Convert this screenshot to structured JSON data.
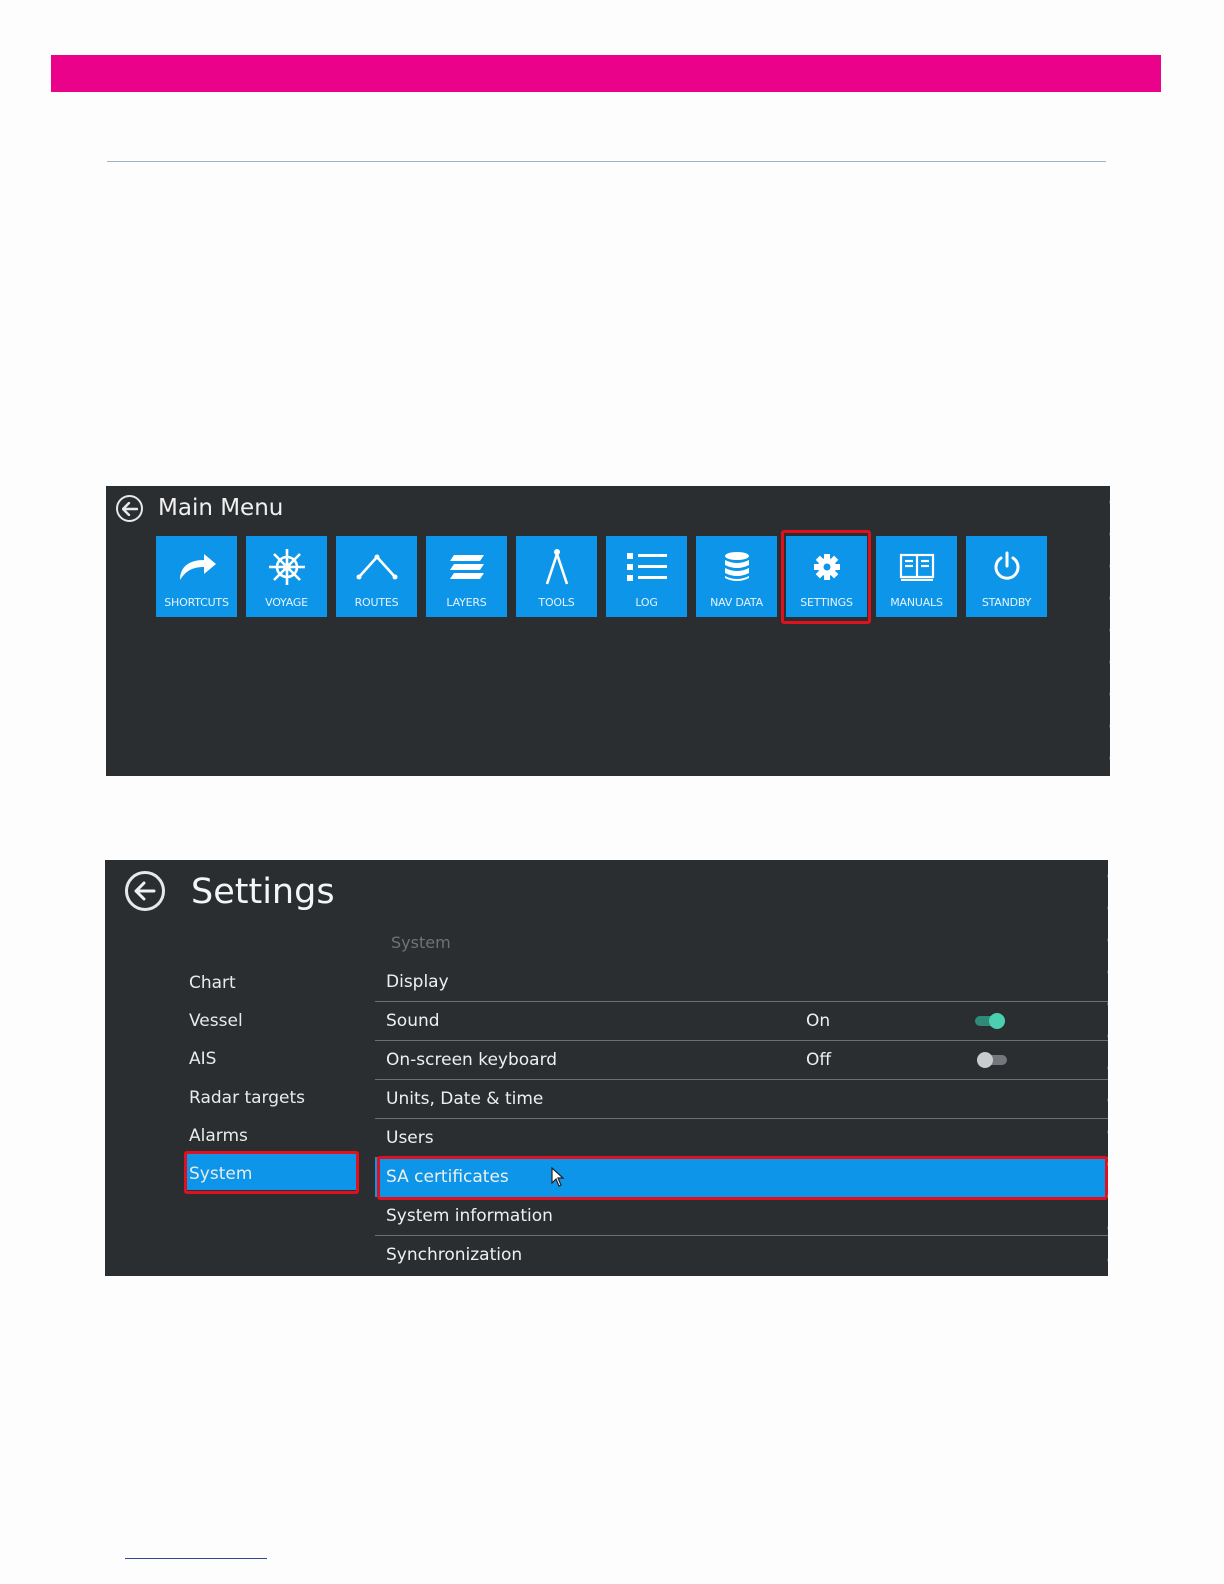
{
  "colors": {
    "accent_bar": "#ea028a",
    "tile_blue": "#0d96e9",
    "panel_bg": "#2a2e31",
    "highlight_red": "#e0101e",
    "toggle_on": "#4ccfb0"
  },
  "main_menu": {
    "title": "Main Menu",
    "tiles": [
      {
        "label": "SHORTCUTS",
        "icon": "shortcut-arrow-icon"
      },
      {
        "label": "VOYAGE",
        "icon": "ship-wheel-icon"
      },
      {
        "label": "ROUTES",
        "icon": "route-icon"
      },
      {
        "label": "LAYERS",
        "icon": "layers-icon"
      },
      {
        "label": "TOOLS",
        "icon": "compass-tool-icon"
      },
      {
        "label": "LOG",
        "icon": "list-icon"
      },
      {
        "label": "NAV DATA",
        "icon": "database-icon"
      },
      {
        "label": "SETTINGS",
        "icon": "gear-icon",
        "highlighted": true
      },
      {
        "label": "MANUALS",
        "icon": "book-icon"
      },
      {
        "label": "STANDBY",
        "icon": "power-icon"
      }
    ]
  },
  "settings": {
    "title": "Settings",
    "section_label": "System",
    "nav": [
      "Chart",
      "Vessel",
      "AIS",
      "Radar targets",
      "Alarms",
      "System"
    ],
    "selected_nav": "System",
    "rows": [
      {
        "label": "Display",
        "value": ""
      },
      {
        "label": "Sound",
        "value": "On",
        "toggle": "on"
      },
      {
        "label": "On-screen keyboard",
        "value": "Off",
        "toggle": "off"
      },
      {
        "label": "Units, Date & time",
        "value": ""
      },
      {
        "label": "Users",
        "value": ""
      },
      {
        "label": "SA certificates",
        "value": "",
        "selected": true
      },
      {
        "label": "System information",
        "value": ""
      },
      {
        "label": "Synchronization",
        "value": ""
      }
    ]
  }
}
